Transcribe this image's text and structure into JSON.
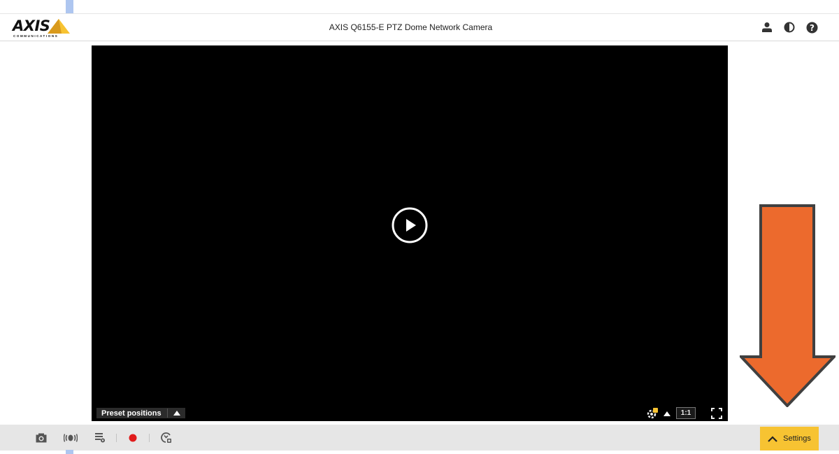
{
  "header": {
    "logo_text": "AXIS",
    "logo_subtext": "COMMUNICATIONS",
    "title": "AXIS Q6155-E PTZ Dome Network Camera",
    "icons": [
      "user-icon",
      "contrast-icon",
      "help-icon"
    ]
  },
  "video": {
    "play_icon": "play-icon",
    "preset_label": "Preset positions",
    "aspect_label": "1:1",
    "controls": [
      "ptz-settings-icon",
      "caret-up-icon",
      "fullscreen-icon"
    ]
  },
  "toolbar": {
    "buttons": [
      "snapshot-icon",
      "audio-icon",
      "stream-info-icon",
      "record-icon",
      "focus-icon"
    ],
    "settings_label": "Settings"
  },
  "colors": {
    "accent": "#f7c332",
    "arrow_fill": "#ec6a2d",
    "arrow_stroke": "#404040",
    "record": "#e01b1b"
  }
}
